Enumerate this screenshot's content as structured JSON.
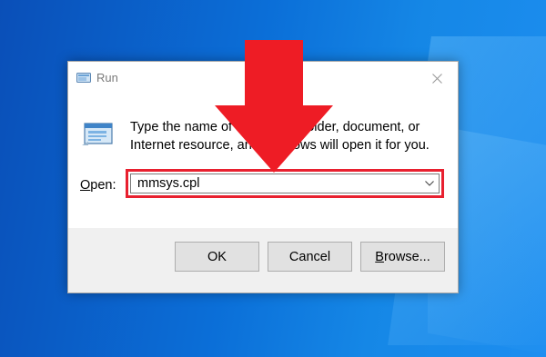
{
  "window": {
    "title": "Run",
    "close_icon": "close-icon"
  },
  "prompt": {
    "line1": "Type the name of a program, folder, document, or",
    "line2": "Internet resource, and Windows will open it for you."
  },
  "open_field": {
    "label_first": "O",
    "label_rest": "pen:",
    "value": "mmsys.cpl",
    "highlight_color": "#e8202f"
  },
  "buttons": {
    "ok": "OK",
    "cancel": "Cancel",
    "browse_first": "B",
    "browse_rest": "rowse..."
  },
  "annotation": {
    "arrow_color": "#ee1c25",
    "arrow_icon": "down-arrow-icon"
  }
}
